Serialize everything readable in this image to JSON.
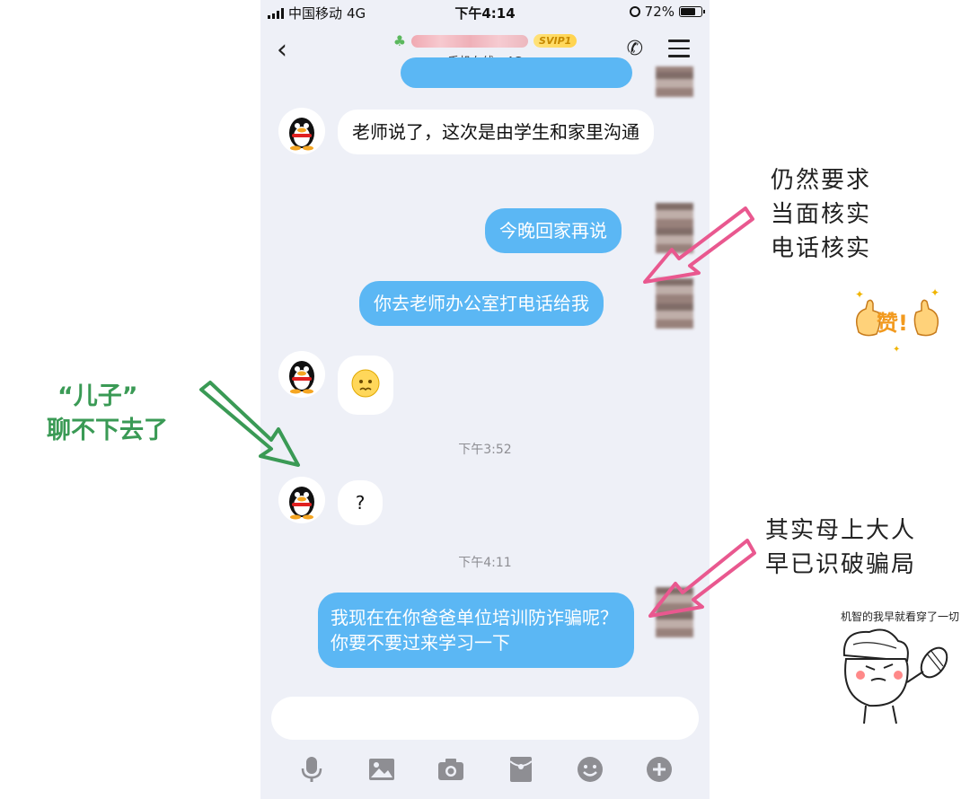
{
  "status_bar": {
    "carrier": "中国移动",
    "network": "4G",
    "time": "下午4:14",
    "battery": "72%"
  },
  "header": {
    "badge": "SVIP1",
    "subtitle": "手机在线 - 4G"
  },
  "messages": [
    {
      "side": "in",
      "text": "老师说了，这次是由学生和家里沟通"
    },
    {
      "side": "out",
      "text": "今晚回家再说"
    },
    {
      "side": "out",
      "text": "你去老师办公室打电话给我"
    },
    {
      "side": "in",
      "type": "emoji",
      "emoji": "worried-face"
    },
    {
      "type": "timestamp",
      "text": "下午3:52"
    },
    {
      "side": "in",
      "text": "?"
    },
    {
      "type": "timestamp",
      "text": "下午4:11"
    },
    {
      "side": "out",
      "text": "我现在在你爸爸单位培训防诈骗呢？你要不要过来学习一下"
    }
  ],
  "toolbar": [
    "microphone-icon",
    "image-icon",
    "camera-icon",
    "red-packet-icon",
    "emoji-icon",
    "plus-icon"
  ],
  "annotations": {
    "left_quote": "“儿子”",
    "left_text": "聊不下去了",
    "right_top": [
      "仍然要求",
      "当面核实",
      "电话核实"
    ],
    "like_sticker": "赞!",
    "right_bottom": [
      "其实母上大人",
      "早已识破骗局"
    ],
    "doodle_caption": "机智的我早就看穿了一切"
  },
  "colors": {
    "chat_bg": "#eef0f7",
    "out_bubble": "#5bb7f4",
    "in_bubble": "#ffffff",
    "green_note": "#3a9a55",
    "pink_arrow": "#e9588f"
  }
}
